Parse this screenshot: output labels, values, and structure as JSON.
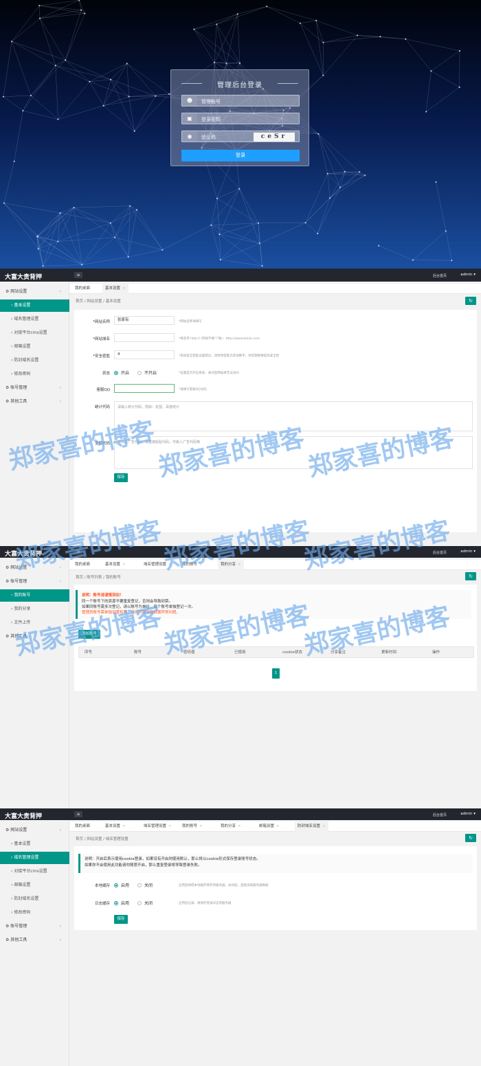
{
  "login": {
    "title": "管理后台登录",
    "username_placeholder": "管理账号",
    "password_placeholder": "登录密码",
    "captcha_placeholder": "验证码",
    "captcha_text": "ceSr",
    "login_button": "登录"
  },
  "app": {
    "logo": "大富大贵背押",
    "top_link": "后台首页",
    "admin": "admin"
  },
  "panel1": {
    "sidebar": [
      {
        "label": "网站设置",
        "type": "group"
      },
      {
        "label": "基本设置",
        "type": "sub",
        "active": true
      },
      {
        "label": "域名管理设置",
        "type": "sub"
      },
      {
        "label": "对接平台cms设置",
        "type": "sub"
      },
      {
        "label": "邮箱设置",
        "type": "sub"
      },
      {
        "label": "防封域名设置",
        "type": "sub"
      },
      {
        "label": "修改密码",
        "type": "sub"
      },
      {
        "label": "账号管理",
        "type": "group"
      },
      {
        "label": "其他工具",
        "type": "group"
      }
    ],
    "tabs": [
      "我的桌面",
      "基本设置"
    ],
    "breadcrumb": "首页 / 网站设置 / 基本设置",
    "fields": {
      "site_name_label": "*网站名称",
      "site_name_value": "张家有",
      "site_name_hint": "*网站名称请填写",
      "site_url_label": "*网站域名",
      "site_url_hint": "*域名带 http://  (例如不要\"/\"尾)：http://www.baidu.com",
      "key_label": "*安全密匙",
      "key_value": "4",
      "key_hint": "*系统安全密匙设置建议，请修改密匙为其他数字，并定期更换提高安全性",
      "state_label": "状态",
      "state_on": "开启",
      "state_off": "不开启",
      "state_hint": "*设置是否开启系统，关闭后网站将无法访问",
      "qq_label": "客服QQ",
      "qq_hint": "*请填写客服QQ号码",
      "stat_label": "统计代码",
      "stat_placeholder": "请输入统计代码，例如：友盟、百度统计",
      "ad_label": "全局代码",
      "ad_placeholder": "可以是广告代码，请直接粘贴代码，可嵌入广告代码等",
      "save": "保存"
    }
  },
  "panel2": {
    "sidebar": [
      {
        "label": "网站设置",
        "type": "group"
      },
      {
        "label": "账号管理",
        "type": "group"
      },
      {
        "label": "我的账号",
        "type": "sub",
        "active": true
      },
      {
        "label": "我的分享",
        "type": "sub"
      },
      {
        "label": "文件上传",
        "type": "sub"
      },
      {
        "label": "其他工具",
        "type": "group"
      }
    ],
    "tabs": [
      "我的桌面",
      "基本设置",
      "域名管理设置",
      "我的账号",
      "我的分享"
    ],
    "breadcrumb": "首页 / 账号列表 / 我的账号",
    "notice": [
      "说明：账号请谨慎添加！",
      "同一个账号下的资源不要重复登记，否则会导致封禁。",
      "如果同账号需多次登记，请以账号为单位，每个账号单独登记一次。",
      "管理员账号需单独设置权限，否则可能导致数据异常问题。"
    ],
    "add_button": "添加账号",
    "columns": [
      "序号",
      "账号",
      "密码值",
      "已使用",
      "cookie状态",
      "分享备注",
      "更新时间",
      "操作"
    ],
    "page": "1"
  },
  "panel3": {
    "sidebar": [
      {
        "label": "网站设置",
        "type": "group"
      },
      {
        "label": "基本设置",
        "type": "sub"
      },
      {
        "label": "域名管理设置",
        "type": "sub",
        "active": true
      },
      {
        "label": "对接平台cms设置",
        "type": "sub"
      },
      {
        "label": "邮箱设置",
        "type": "sub"
      },
      {
        "label": "防封域名设置",
        "type": "sub"
      },
      {
        "label": "修改密码",
        "type": "sub"
      },
      {
        "label": "账号管理",
        "type": "group"
      },
      {
        "label": "其他工具",
        "type": "group"
      }
    ],
    "tabs": [
      "我的桌面",
      "基本设置",
      "域名管理设置",
      "我的账号",
      "我的分享",
      "邮箱设置",
      "防封域名设置"
    ],
    "breadcrumb": "首页 / 网站设置 / 域名管理设置",
    "notice": [
      "说明：开启后表示使用cookie登录，如果没有开启则使用默认，那么将以cookie形式保存登录账号状态。",
      "如果你不会使用此功能请勿随意开启，那么重复登录将导致登录失败。"
    ],
    "row1_label": "本地缓存",
    "row1_on": "启用",
    "row1_off": "关闭",
    "row1_hint": "启用后将把本地缓存保存到服务器，关闭后，直接读取服务器数据",
    "row2_label": "日志缓存",
    "row2_on": "启用",
    "row2_off": "关闭",
    "row2_hint": "启用后记录，将保存登录日志到服务器",
    "save": "保存"
  },
  "watermark": "郑家喜的博客"
}
